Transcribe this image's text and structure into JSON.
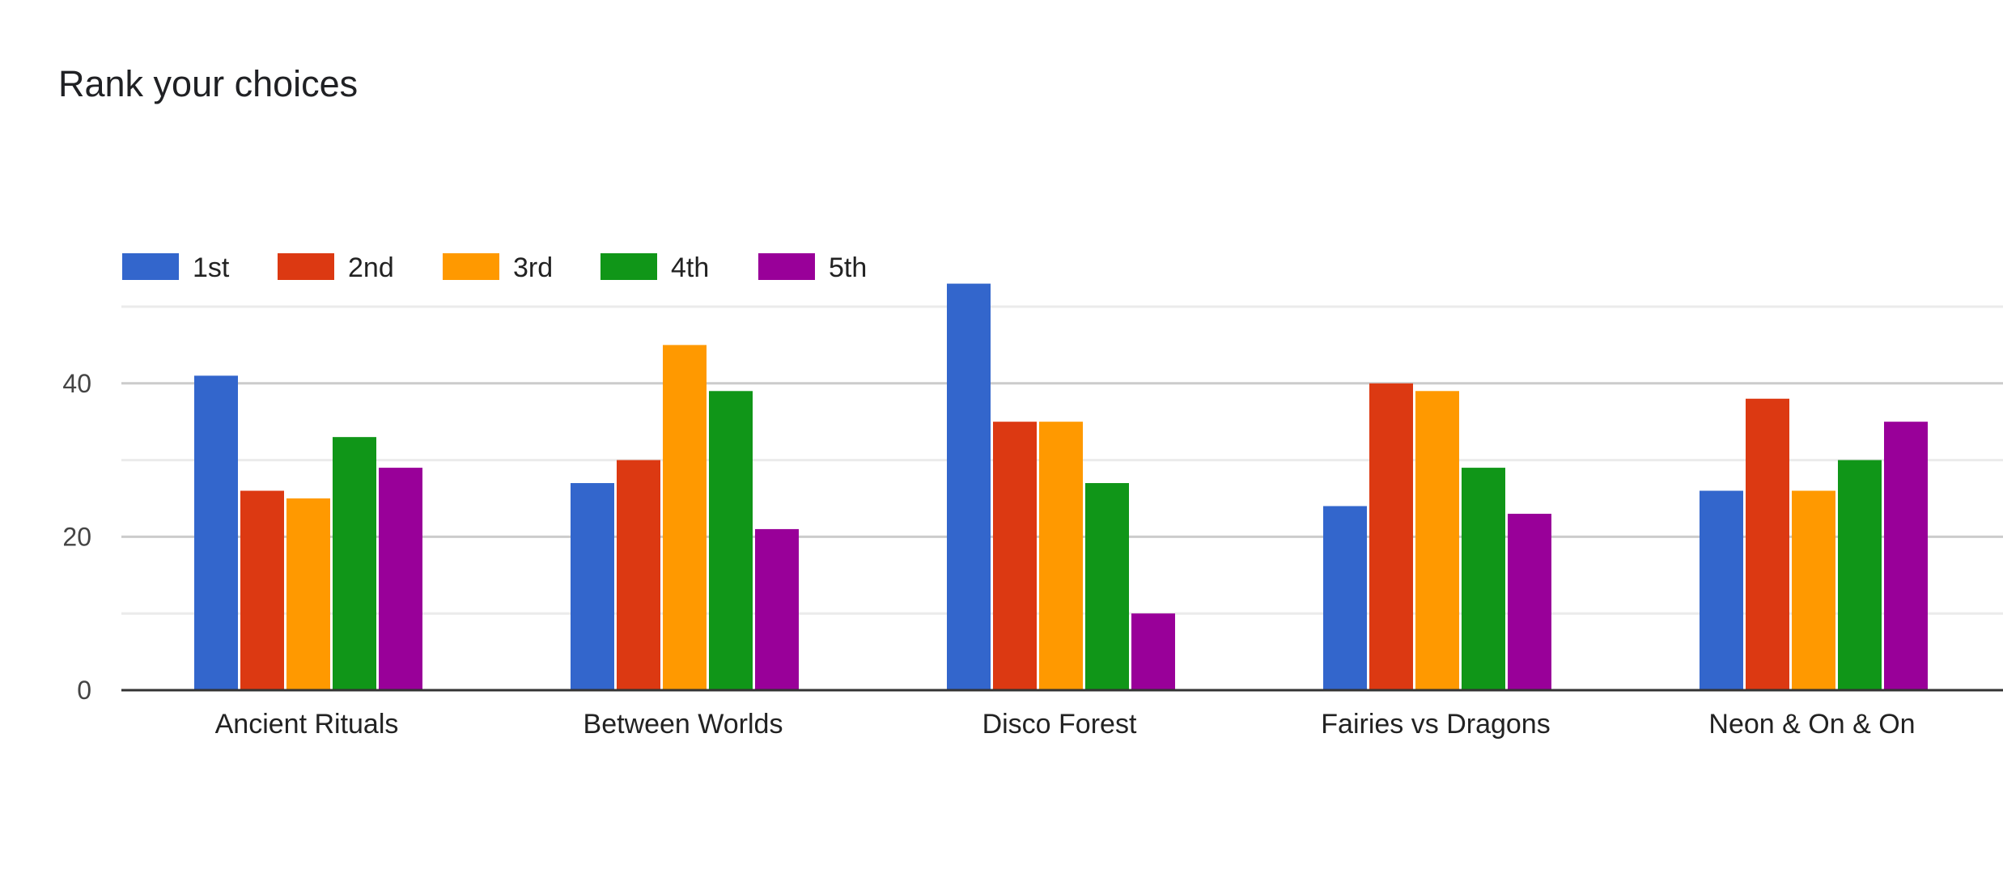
{
  "chart_data": {
    "type": "bar",
    "title": "Rank your choices",
    "xlabel": "",
    "ylabel": "",
    "categories": [
      "Ancient Rituals",
      "Between Worlds",
      "Disco Forest",
      "Fairies vs Dragons",
      "Neon & On & On"
    ],
    "series": [
      {
        "name": "1st",
        "color": "#3366cc",
        "values": [
          41,
          27,
          53,
          24,
          26
        ]
      },
      {
        "name": "2nd",
        "color": "#dc3912",
        "values": [
          26,
          30,
          35,
          40,
          38
        ]
      },
      {
        "name": "3rd",
        "color": "#ff9900",
        "values": [
          25,
          45,
          35,
          39,
          26
        ]
      },
      {
        "name": "4th",
        "color": "#109618",
        "values": [
          33,
          39,
          27,
          29,
          30
        ]
      },
      {
        "name": "5th",
        "color": "#990099",
        "values": [
          29,
          21,
          10,
          23,
          35
        ]
      }
    ],
    "ylim": [
      0,
      50
    ],
    "yticks": [
      0,
      20,
      40
    ],
    "ytick_labels": [
      "0",
      "20",
      "40"
    ],
    "minor_gridlines": [
      10,
      30,
      50
    ],
    "grid": true,
    "legend_position": "top-left"
  }
}
